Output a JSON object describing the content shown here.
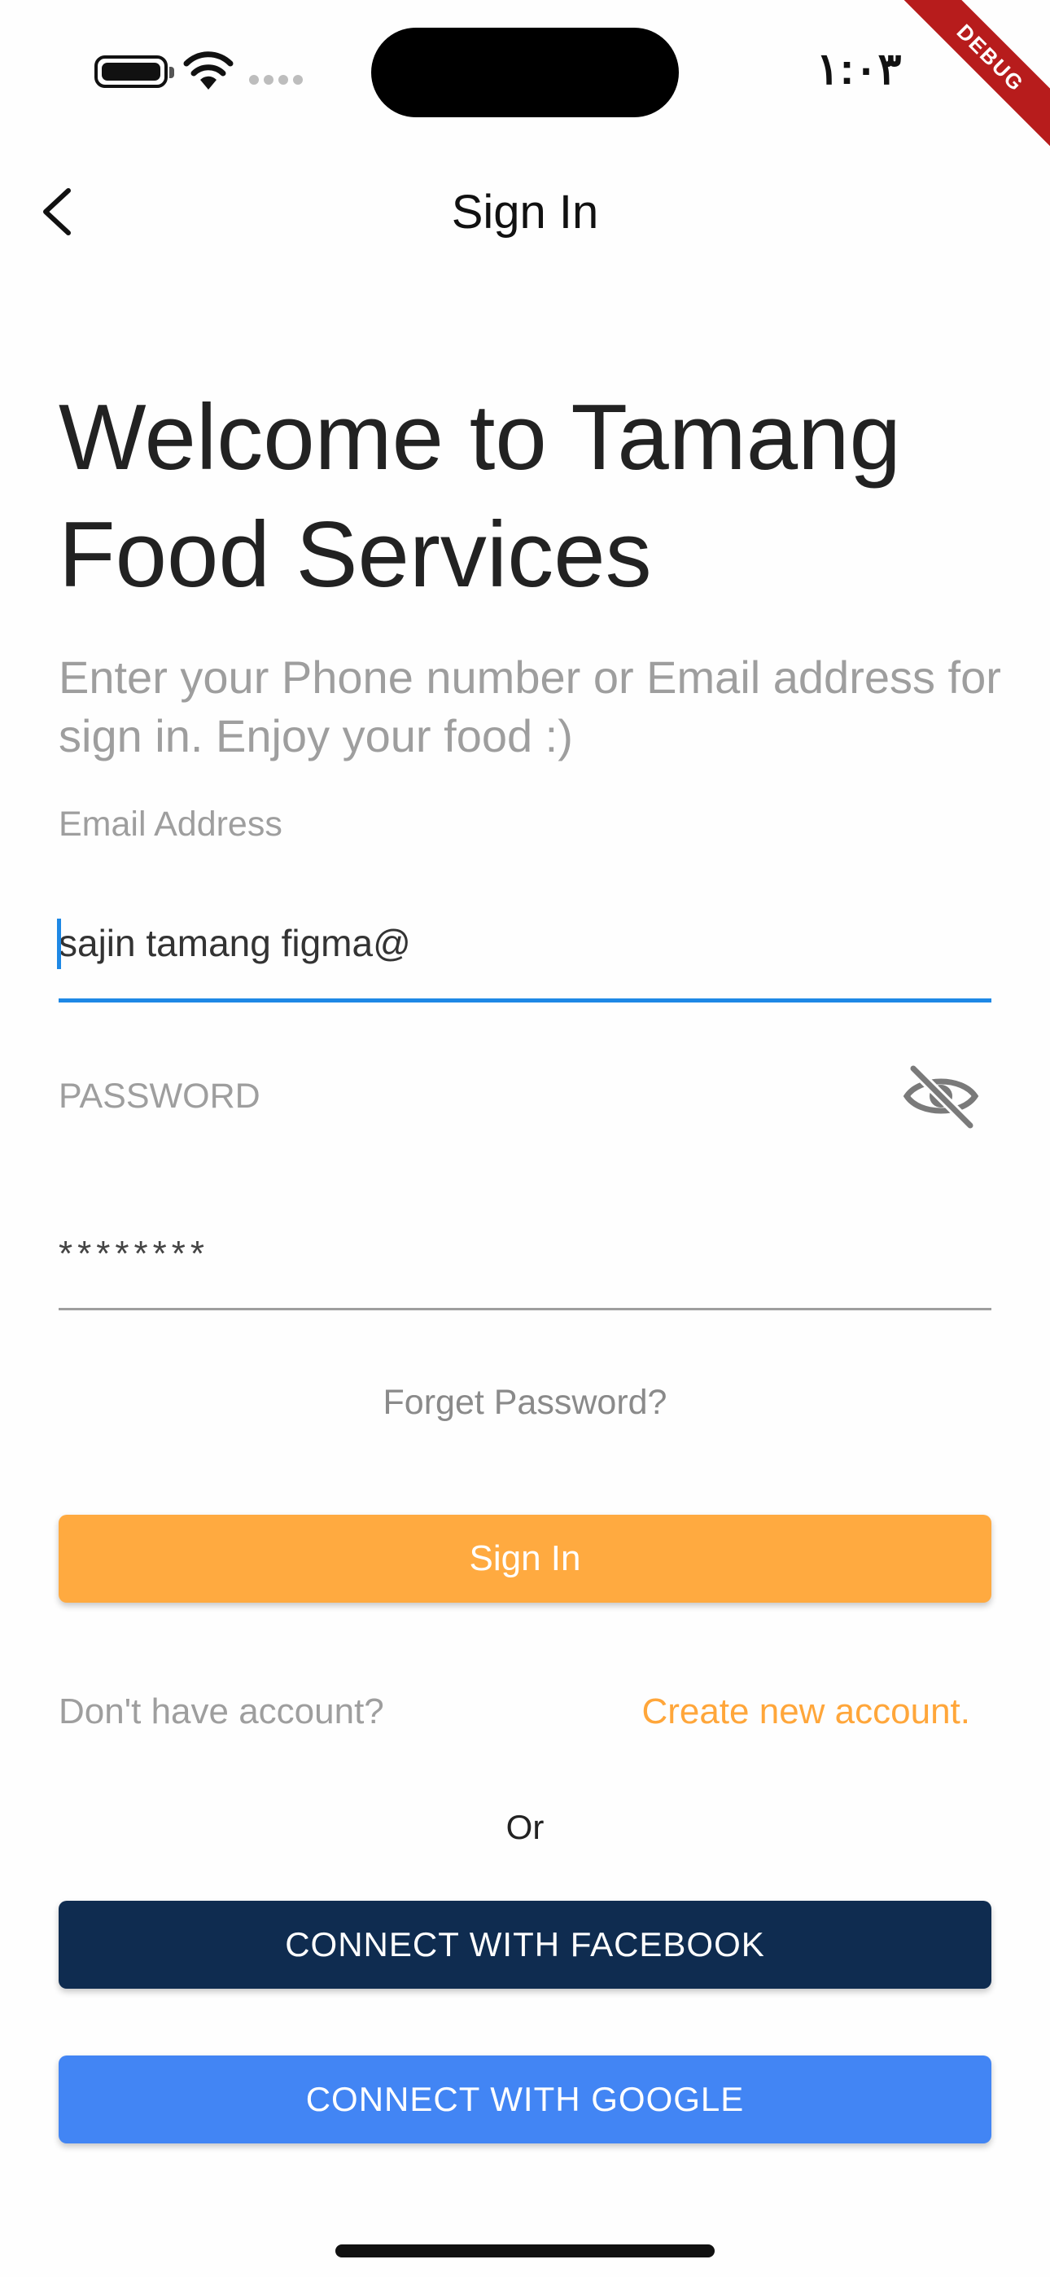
{
  "status_bar": {
    "time": "١:٠٣",
    "debug_label": "DEBUG"
  },
  "app_bar": {
    "title": "Sign In",
    "back_icon": "chevron-left-icon"
  },
  "header": {
    "title": "Welcome to Tamang Food Services",
    "subtitle": "Enter your Phone number or Email address for sign in. Enjoy your food :)"
  },
  "form": {
    "email": {
      "label": "Email Address",
      "value": "sajin tamang figma@"
    },
    "password": {
      "label": "PASSWORD",
      "value": "********",
      "visibility_icon": "eye-off-icon"
    },
    "forgot_label": "Forget Password?",
    "submit_label": "Sign In"
  },
  "signup": {
    "prompt": "Don't have account?",
    "link": "Create new account."
  },
  "divider_text": "Or",
  "social": {
    "facebook_label": "CONNECT WITH FACEBOOK",
    "google_label": "CONNECT WITH GOOGLE"
  },
  "colors": {
    "accent": "#FFAA40",
    "focus": "#1E88E5",
    "facebook": "#0F2C50",
    "google": "#4285F4",
    "link": "#FFA63A",
    "muted": "#9E9E9E"
  }
}
